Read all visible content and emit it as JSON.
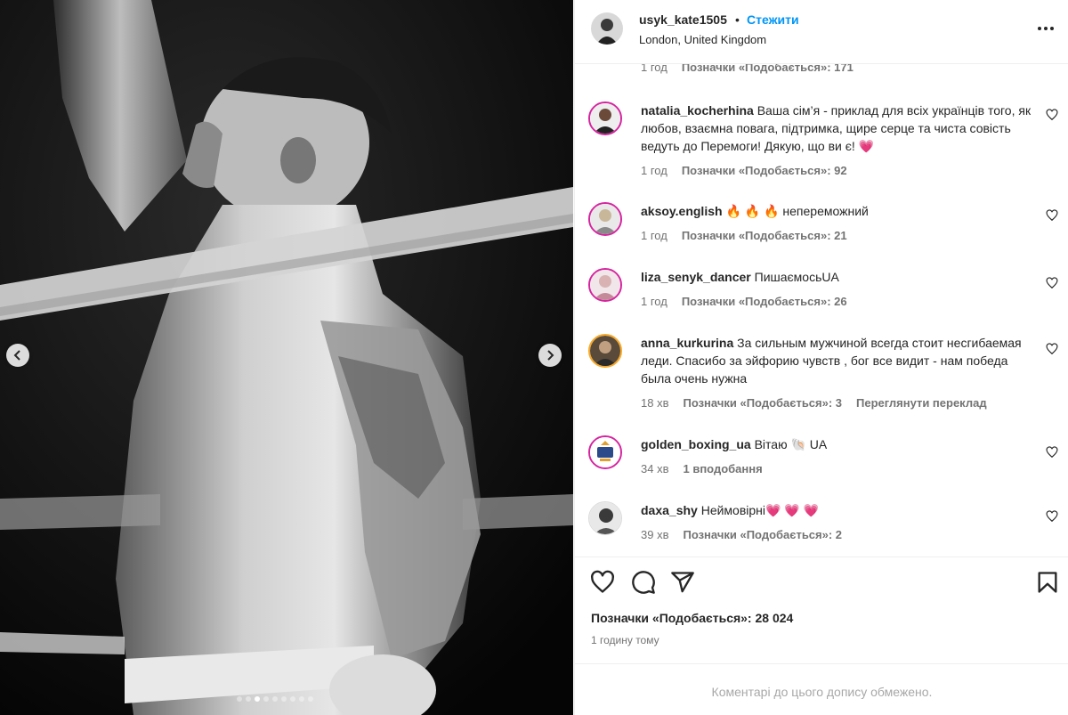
{
  "post": {
    "username": "usyk_kate1505",
    "bullet": "•",
    "follow_label": "Стежити",
    "location": "London, United Kingdom",
    "partial_comment": {
      "time": "1 год",
      "likes": "Позначки «Подобається»: 171"
    }
  },
  "comments": [
    {
      "username": "natalia_kocherhina",
      "text": "Ваша сім’я - приклад для всіх українців того, як любов, взаємна повага, підтримка, щире серце та чиста совість ведуть до Перемоги! Дякую, що ви є! 💗",
      "time": "1 год",
      "likes": "Позначки «Подобається»: 92",
      "extra": ""
    },
    {
      "username": "aksoy.english",
      "text": "🔥 🔥 🔥 непереможний",
      "time": "1 год",
      "likes": "Позначки «Подобається»: 21",
      "extra": ""
    },
    {
      "username": "liza_senyk_dancer",
      "text": "ПишаємосьUA",
      "time": "1 год",
      "likes": "Позначки «Подобається»: 26",
      "extra": ""
    },
    {
      "username": "anna_kurkurina",
      "text": "За сильным мужчиной всегда стоит несгибаемая леди. Спасибо за эйфорию чувств , бог все видит - нам победа была очень нужна",
      "time": "18 хв",
      "likes": "Позначки «Подобається»: 3",
      "extra": "Переглянути переклад"
    },
    {
      "username": "golden_boxing_ua",
      "text": "Вітаю 🐚 UA",
      "time": "34 хв",
      "likes": "1 вподобання",
      "extra": ""
    },
    {
      "username": "daxa_shy",
      "text": "Неймовірні💗 💗 💗",
      "time": "39 хв",
      "likes": "Позначки «Подобається»: 2",
      "extra": ""
    }
  ],
  "actions": {
    "likes": "Позначки «Подобається»: 28 024",
    "time": "1 годину тому"
  },
  "footer_note": "Коментарі до цього допису обмежено.",
  "carousel": {
    "total_slides": 9,
    "active_slide": 3
  },
  "icons": {
    "like": "heart-icon",
    "comment": "comment-icon",
    "share": "share-icon",
    "save": "bookmark-icon",
    "more": "more-icon",
    "prev": "chevron-left-icon",
    "next": "chevron-right-icon"
  },
  "colors": {
    "link": "#0095f6",
    "muted": "#737373",
    "ring": "#d6249f"
  }
}
